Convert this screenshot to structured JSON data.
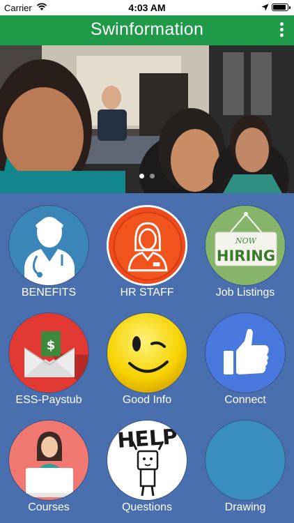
{
  "status_bar": {
    "carrier": "Carrier",
    "time": "4:03 AM",
    "battery_level": 0.9
  },
  "app_bar": {
    "title": "Swinformation"
  },
  "carousel": {
    "page_count": 2,
    "active_index": 0
  },
  "tiles": [
    {
      "label": "BENEFITS",
      "icon": "doctor-icon",
      "color": "#3a86b8"
    },
    {
      "label": "HR STAFF",
      "icon": "hr-staff-icon",
      "color": "#f04a1c"
    },
    {
      "label": "Job Listings",
      "icon": "now-hiring-sign-icon",
      "color": "#86b56a"
    },
    {
      "label": "ESS-Paystub",
      "icon": "paystub-envelope-icon",
      "color": "#e23a33"
    },
    {
      "label": "Good Info",
      "icon": "winking-smiley-icon",
      "color": "#f5d200"
    },
    {
      "label": "Connect",
      "icon": "thumbs-up-icon",
      "color": "#4877dd"
    },
    {
      "label": "Courses",
      "icon": "student-laptop-icon",
      "color": "#f07870"
    },
    {
      "label": "Questions",
      "icon": "help-sign-icon",
      "color": "#ffffff"
    },
    {
      "label": "Drawing",
      "icon": "drawing-icon",
      "color": "#3a8fc0"
    }
  ],
  "job_sign": {
    "line1": "NOW",
    "line2": "HIRING"
  },
  "help_sign": {
    "text": "HELP"
  },
  "paystub_symbol": "$"
}
